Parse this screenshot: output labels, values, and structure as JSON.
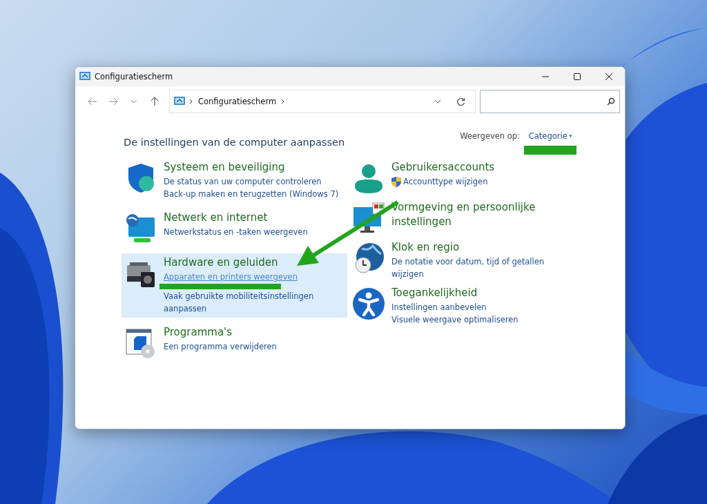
{
  "window": {
    "title": "Configuratiescherm"
  },
  "address_bar": {
    "path": [
      "Configuratiescherm"
    ]
  },
  "search": {
    "kind": "empty"
  },
  "heading": "De instellingen van de computer aanpassen",
  "view_by": {
    "label": "Weergeven op:",
    "value": "Categorie",
    "caret": "▾",
    "marked": true
  },
  "columns": [
    {
      "categories": [
        {
          "title": "Systeem en beveiliging",
          "selected": false,
          "links": [
            {
              "kind": "link",
              "text": "De status van uw computer controleren"
            },
            {
              "kind": "link",
              "text": "Back-up maken en terugzetten (Windows 7)"
            }
          ]
        },
        {
          "title": "Netwerk en internet",
          "selected": false,
          "links": [
            {
              "kind": "link",
              "text": "Netwerkstatus en -taken weergeven"
            }
          ]
        },
        {
          "title": "Hardware en geluiden",
          "selected": true,
          "links": [
            {
              "kind": "link",
              "text": "Apparaten en printers weergeven"
            },
            {
              "kind": "marker"
            },
            {
              "kind": "link",
              "text": "Vaak gebruikte mobiliteitsinstellingen aanpassen"
            }
          ]
        },
        {
          "title": "Programma's",
          "selected": false,
          "links": [
            {
              "kind": "link",
              "text": "Een programma verwijderen"
            }
          ]
        }
      ]
    },
    {
      "categories": [
        {
          "title": "Gebruikersaccounts",
          "selected": false,
          "links": [
            {
              "kind": "admin",
              "text": "Accounttype wijzigen"
            }
          ]
        },
        {
          "title": "Vormgeving en persoonlijke instellingen",
          "selected": false
        },
        {
          "title": "Klok en regio",
          "selected": false,
          "links": [
            {
              "kind": "link",
              "text": "De notatie voor datum, tijd of getallen wijzigen"
            }
          ]
        },
        {
          "title": "Toegankelijkheid",
          "selected": false,
          "links": [
            {
              "kind": "link",
              "text": "Instellingen aanbevelen"
            },
            {
              "kind": "link",
              "text": "Visuele weergave optimaliseren"
            }
          ]
        }
      ]
    }
  ]
}
